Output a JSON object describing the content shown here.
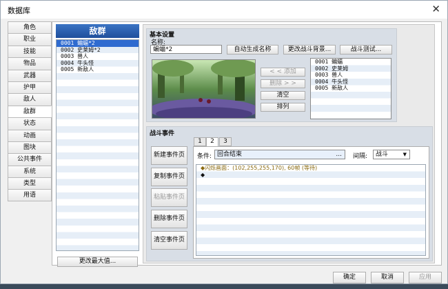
{
  "window": {
    "title": "数据库",
    "close": "✕"
  },
  "tabs": [
    "角色",
    "职业",
    "技能",
    "物品",
    "武器",
    "护甲",
    "敌人",
    "敌群",
    "状态",
    "动画",
    "图块",
    "公共事件",
    "系统",
    "类型",
    "用语"
  ],
  "active_tab": "敌群",
  "list": {
    "header": "敌群",
    "items": [
      "0001 蝙蝠*2",
      "0002 史莱姆*2",
      "0003 兽人",
      "0004 牛头怪",
      "0005 新敌人"
    ],
    "selected": 0,
    "change_max": "更改最大值..."
  },
  "basic": {
    "label": "基本设置",
    "name_label": "名称:",
    "name_value": "蝙蝠*2",
    "auto_name": "自动生成名称",
    "change_bg": "更改战斗背景...",
    "battle_test": "战斗测试...",
    "add": "< < 添加",
    "remove": "删除 > >",
    "clear": "清空",
    "arrange": "排列",
    "members": [
      "0001 蝙蝠",
      "0002 史莱姆",
      "0003 兽人",
      "0004 牛头怪",
      "0005 新敌人"
    ]
  },
  "events": {
    "label": "战斗事件",
    "page_tabs": [
      "1",
      "2",
      "3"
    ],
    "active_page": "2",
    "new_page": "新建事件页",
    "copy_page": "复制事件页",
    "paste_page": "粘贴事件页",
    "delete_page": "删除事件页",
    "clear_page": "清空事件页",
    "condition_label": "条件:",
    "condition_value": "回合结束",
    "condition_more": "...",
    "span_label": "间隔:",
    "span_value": "战斗",
    "commands": [
      "◆闪烁画面：(102,255,255,170), 60帧 (等待)",
      "◆"
    ]
  },
  "footer": {
    "ok": "确定",
    "cancel": "取消",
    "apply": "应用"
  },
  "colors": {
    "selection": "#2f6bd0",
    "header": "#2a5fb0",
    "command_text": "#8a6a10"
  }
}
